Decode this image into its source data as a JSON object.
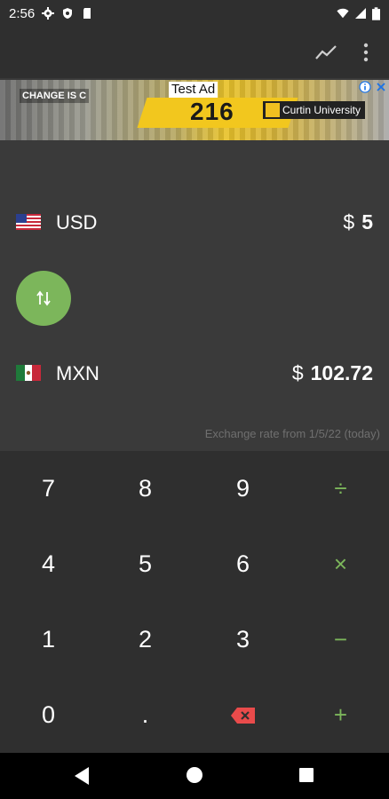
{
  "status_bar": {
    "time": "2:56"
  },
  "ad": {
    "label": "Test Ad",
    "headline": "CHANGE IS C",
    "building_number": "216",
    "sponsor": "Curtin University"
  },
  "converter": {
    "from": {
      "code": "USD",
      "symbol": "$",
      "amount": "5"
    },
    "to": {
      "code": "MXN",
      "symbol": "$",
      "amount": "102.72"
    },
    "rate_note": "Exchange rate from 1/5/22 (today)"
  },
  "keypad": {
    "k7": "7",
    "k8": "8",
    "k9": "9",
    "div": "÷",
    "k4": "4",
    "k5": "5",
    "k6": "6",
    "mul": "×",
    "k1": "1",
    "k2": "2",
    "k3": "3",
    "sub": "−",
    "k0": "0",
    "dot": ".",
    "add": "+"
  },
  "colors": {
    "accent": "#7cb65b",
    "background": "#3a3a3a",
    "keypad_bg": "#2f2f2f",
    "backspace": "#e94b4b"
  }
}
